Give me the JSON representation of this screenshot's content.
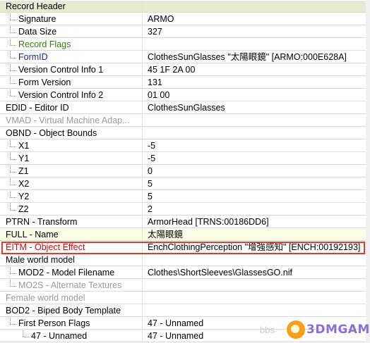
{
  "rows": [
    {
      "label": "Record Header",
      "value": "",
      "kind": "hdr",
      "indent": 0,
      "color": ""
    },
    {
      "label": "Signature",
      "value": "ARMO",
      "kind": "",
      "indent": 1,
      "color": ""
    },
    {
      "label": "Data Size",
      "value": "327",
      "kind": "",
      "indent": 1,
      "color": ""
    },
    {
      "label": "Record Flags",
      "value": "",
      "kind": "",
      "indent": 1,
      "color": "green"
    },
    {
      "label": "FormID",
      "value": "ClothesSunGlasses \"太陽眼鏡\" [ARMO:000E628A]",
      "kind": "",
      "indent": 1,
      "color": "blue"
    },
    {
      "label": "Version Control Info 1",
      "value": "45 1F 2A 00",
      "kind": "",
      "indent": 1,
      "color": ""
    },
    {
      "label": "Form Version",
      "value": "131",
      "kind": "",
      "indent": 1,
      "color": ""
    },
    {
      "label": "Version Control Info 2",
      "value": "01 00",
      "kind": "",
      "indent": 1,
      "color": ""
    },
    {
      "label": "EDID - Editor ID",
      "value": "ClothesSunGlasses",
      "kind": "",
      "indent": 0,
      "color": ""
    },
    {
      "label": "VMAD - Virtual Machine Adap...",
      "value": "",
      "kind": "dim",
      "indent": 0,
      "color": ""
    },
    {
      "label": "OBND - Object Bounds",
      "value": "",
      "kind": "",
      "indent": 0,
      "color": ""
    },
    {
      "label": "X1",
      "value": "-5",
      "kind": "",
      "indent": 1,
      "color": ""
    },
    {
      "label": "Y1",
      "value": "-5",
      "kind": "",
      "indent": 1,
      "color": ""
    },
    {
      "label": "Z1",
      "value": "0",
      "kind": "",
      "indent": 1,
      "color": ""
    },
    {
      "label": "X2",
      "value": "5",
      "kind": "",
      "indent": 1,
      "color": ""
    },
    {
      "label": "Y2",
      "value": "5",
      "kind": "",
      "indent": 1,
      "color": ""
    },
    {
      "label": "Z2",
      "value": "2",
      "kind": "",
      "indent": 1,
      "color": ""
    },
    {
      "label": "PTRN - Transform",
      "value": "ArmorHead [TRNS:00186DD6]",
      "kind": "",
      "indent": 0,
      "color": ""
    },
    {
      "label": "FULL - Name",
      "value": "太陽眼鏡",
      "kind": "full",
      "indent": 0,
      "color": ""
    },
    {
      "label": "EITM - Object Effect",
      "value": "EnchClothingPerception \"增強感知\" [ENCH:00192193]",
      "kind": "sel",
      "indent": 0,
      "color": "red"
    },
    {
      "label": "Male world model",
      "value": "",
      "kind": "",
      "indent": 0,
      "color": ""
    },
    {
      "label": "MOD2 - Model Filename",
      "value": "Clothes\\ShortSleeves\\GlassesGO.nif",
      "kind": "",
      "indent": 1,
      "color": ""
    },
    {
      "label": "MO2S - Alternate Textures",
      "value": "",
      "kind": "dim",
      "indent": 1,
      "color": ""
    },
    {
      "label": "Female world model",
      "value": "",
      "kind": "dim",
      "indent": 0,
      "color": ""
    },
    {
      "label": "BOD2 - Biped Body Template",
      "value": "",
      "kind": "",
      "indent": 0,
      "color": ""
    },
    {
      "label": "First Person Flags",
      "value": "47 - Unnamed",
      "kind": "",
      "indent": 1,
      "color": ""
    },
    {
      "label": "47 - Unnamed",
      "value": "47 - Unnamed",
      "kind": "",
      "indent": 2,
      "color": ""
    }
  ],
  "watermark": {
    "left": "bbs",
    "brand": "3DMGAME"
  }
}
